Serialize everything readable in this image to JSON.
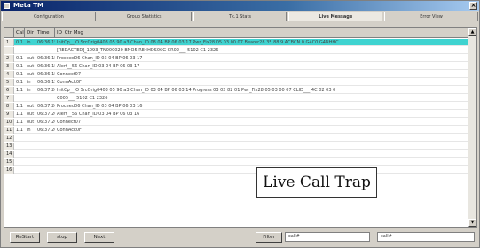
{
  "window": {
    "title": "Meta TM"
  },
  "tabs": [
    {
      "label": "Configuration"
    },
    {
      "label": "Group Statistics"
    },
    {
      "label": "Tk.1 Stats"
    },
    {
      "label": "Live Message",
      "active": true
    },
    {
      "label": "Error View"
    }
  ],
  "table": {
    "columns": [
      "Call",
      "Dir",
      "Time",
      "IO_Ctr Msg"
    ],
    "rows": [
      {
        "num": "1",
        "call": "0.1",
        "dir": "in",
        "time": "06:36:15",
        "msg": "InitCp__IO SrcOrig0403 05 90 a3 Chan_ID 08 04 BP 06 03 17 Pwr_Fix28 05 03 00 07 Bearer28 35 88 9 ACBCN 0 G4C0 G4NHHC",
        "selected": true
      },
      {
        "num": "",
        "call": "",
        "dir": "",
        "time": "",
        "msg": "[REDACTED]_1093_TN000020 BNO5 RE4HDS06G CR02___ 5102 C1 2326"
      },
      {
        "num": "2",
        "call": "0.1",
        "dir": "out",
        "time": "06:36:15",
        "msg": "Proceed06 Chan_ID 03 04 BP 06 03 17"
      },
      {
        "num": "3",
        "call": "0.1",
        "dir": "out",
        "time": "06:36:15",
        "msg": "Alert__56 Chan_ID 03 04 BP 06 03 17"
      },
      {
        "num": "4",
        "call": "0.1",
        "dir": "out",
        "time": "06:36:15",
        "msg": "Connect07"
      },
      {
        "num": "5",
        "call": "0.1",
        "dir": "in",
        "time": "06:36:15",
        "msg": "ConnAck0F"
      },
      {
        "num": "6",
        "call": "1.1",
        "dir": "in",
        "time": "06:37:26",
        "msg": "InitCp__IO SrcOrig0403 05 90 a3 Chan_ID 03 04 BP 06 03 14 Progress 03 02 82 01 Pwr_Fix28 05 03 00 07 CLID___ 4C 02 03 0"
      },
      {
        "num": "7",
        "call": "",
        "dir": "",
        "time": "",
        "msg": "C005___ 5102 C1 2326"
      },
      {
        "num": "8",
        "call": "1.1",
        "dir": "out",
        "time": "06:37:26",
        "msg": "Proceed06 Chan_ID 03 04 BP 06 03 16"
      },
      {
        "num": "9",
        "call": "1.1",
        "dir": "out",
        "time": "06:37:26",
        "msg": "Alert__56 Chan_ID 03 04 BP 06 03 16"
      },
      {
        "num": "10",
        "call": "1.1",
        "dir": "out",
        "time": "06:37:26",
        "msg": "Connect07"
      },
      {
        "num": "11",
        "call": "1.1",
        "dir": "in",
        "time": "06:37:26",
        "msg": "ConnAck0F"
      },
      {
        "num": "12",
        "call": "",
        "dir": "",
        "time": "",
        "msg": ""
      },
      {
        "num": "13",
        "call": "",
        "dir": "",
        "time": "",
        "msg": ""
      },
      {
        "num": "14",
        "call": "",
        "dir": "",
        "time": "",
        "msg": ""
      },
      {
        "num": "15",
        "call": "",
        "dir": "",
        "time": "",
        "msg": ""
      },
      {
        "num": "16",
        "call": "",
        "dir": "",
        "time": "",
        "msg": ""
      }
    ]
  },
  "overlay": {
    "label": "Live Call Trap"
  },
  "toolbar": {
    "buttons": [
      {
        "label": "ReStart"
      },
      {
        "label": "stop"
      },
      {
        "label": "Next"
      }
    ],
    "filter_button": "Filter",
    "filter_value_1": "call#",
    "filter_value_2": "call#"
  },
  "colors": {
    "selected_row": "#3fd3d0",
    "titlebar": "#0a246a",
    "chrome": "#d4d0c8"
  }
}
